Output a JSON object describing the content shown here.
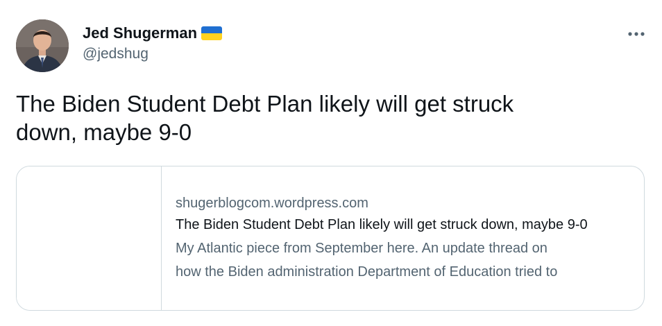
{
  "author": {
    "display_name": "Jed Shugerman",
    "handle": "@jedshug",
    "badge_icon": "ukraine-flag-icon",
    "flag_colors": [
      "#1f6fd1",
      "#ffd21f"
    ]
  },
  "menu": {
    "icon": "more-horizontal-icon"
  },
  "tweet": {
    "text_line1": "The Biden Student Debt Plan likely will get struck",
    "text_line2": "down, maybe 9-0"
  },
  "link_card": {
    "domain": "shugerblogcom.wordpress.com",
    "title": "The Biden Student Debt Plan likely will get struck down, maybe 9-0",
    "description_line1": "My Atlantic piece from September here. An update thread on",
    "description_line2": "how the Biden administration Department of Education tried to"
  }
}
